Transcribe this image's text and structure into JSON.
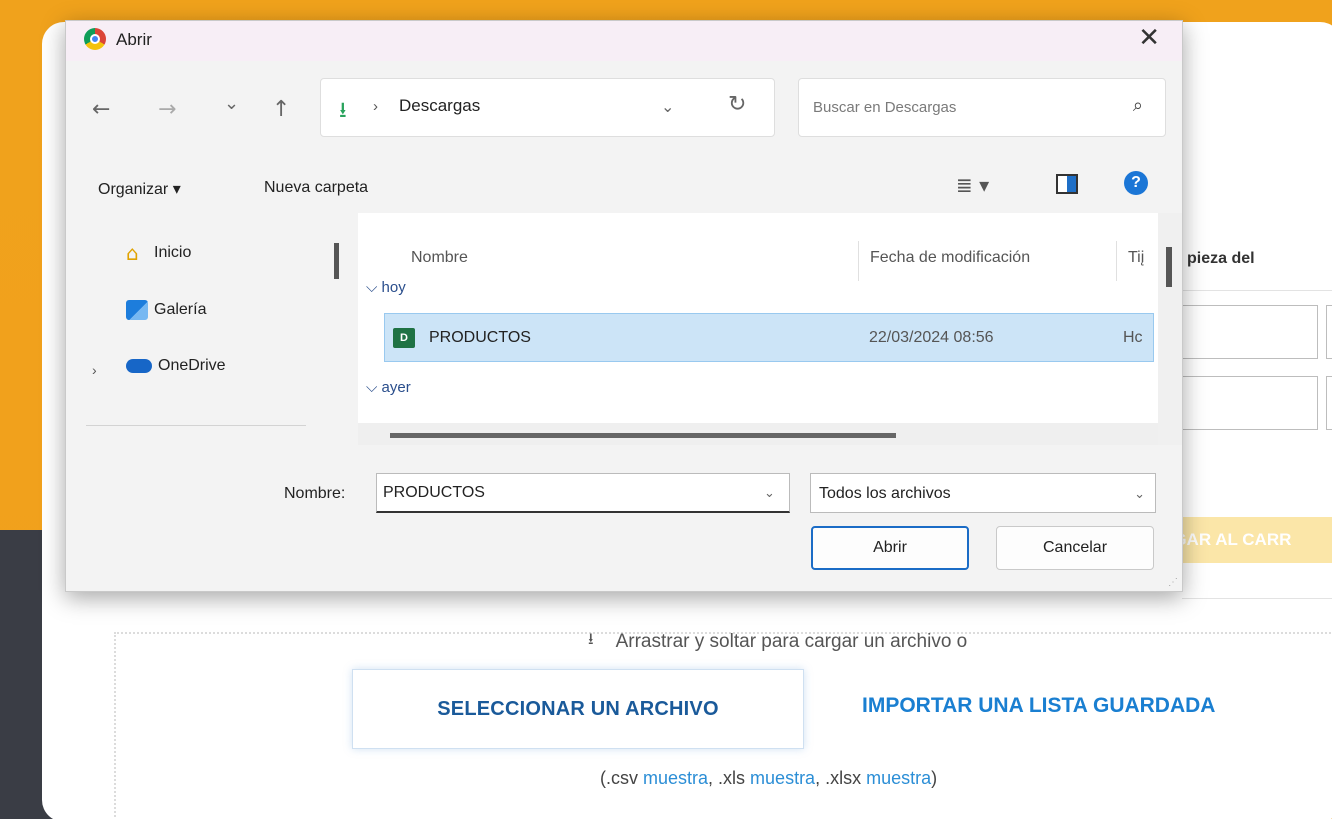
{
  "page": {
    "partial_heading": "pieza del",
    "add_to_cart_partial": "EGAR AL CARR",
    "drop_hint": "Arrastrar y soltar para cargar un archivo o",
    "select_file_button": "SELECCIONAR UN ARCHIVO",
    "import_list_button": "IMPORTAR UNA LISTA GUARDADA",
    "formats": {
      "open": "(.csv ",
      "sample1": "muestra",
      "sep1": ", .xls ",
      "sample2": "muestra",
      "sep2": ", .xlsx ",
      "sample3": "muestra",
      "close": ")"
    }
  },
  "dialog": {
    "title": "Abrir",
    "close_glyph": "✕",
    "nav": {
      "back": "←",
      "forward": "→",
      "recent": "⌄",
      "up": "↑"
    },
    "address": {
      "download_glyph": "⭳",
      "separator": "›",
      "path": "Descargas",
      "dropdown": "⌄",
      "refresh": "↻"
    },
    "search_placeholder": "Buscar en Descargas",
    "search_glyph": "⌕",
    "toolbar": {
      "organize": "Organizar ▾",
      "new_folder": "Nueva carpeta",
      "view_glyph": "≣ ▾",
      "help_glyph": "?"
    },
    "nav_pane": {
      "items": [
        {
          "label": "Inicio",
          "icon": "home-icon"
        },
        {
          "label": "Galería",
          "icon": "gallery-icon"
        },
        {
          "label": "OneDrive",
          "icon": "cloud-icon"
        }
      ],
      "expand_glyph": "›"
    },
    "columns": {
      "name": "Nombre",
      "date": "Fecha de modificación",
      "type": "Tiį"
    },
    "groups": {
      "today": "⌵ hoy",
      "yesterday": "⌵ ayer"
    },
    "files": [
      {
        "name": "PRODUCTOS",
        "date": "22/03/2024 08:56",
        "type": "Hc",
        "icon_text": "D"
      }
    ],
    "filename_label": "Nombre:",
    "filename_value": "PRODUCTOS",
    "filetype_value": "Todos los archivos",
    "dd_glyph": "⌄",
    "open_button": "Abrir",
    "cancel_button": "Cancelar"
  },
  "colors": {
    "accent": "#1b6cc6",
    "selection": "#cce4f7",
    "background": "#f0a21c",
    "link": "#1a7fd1"
  }
}
